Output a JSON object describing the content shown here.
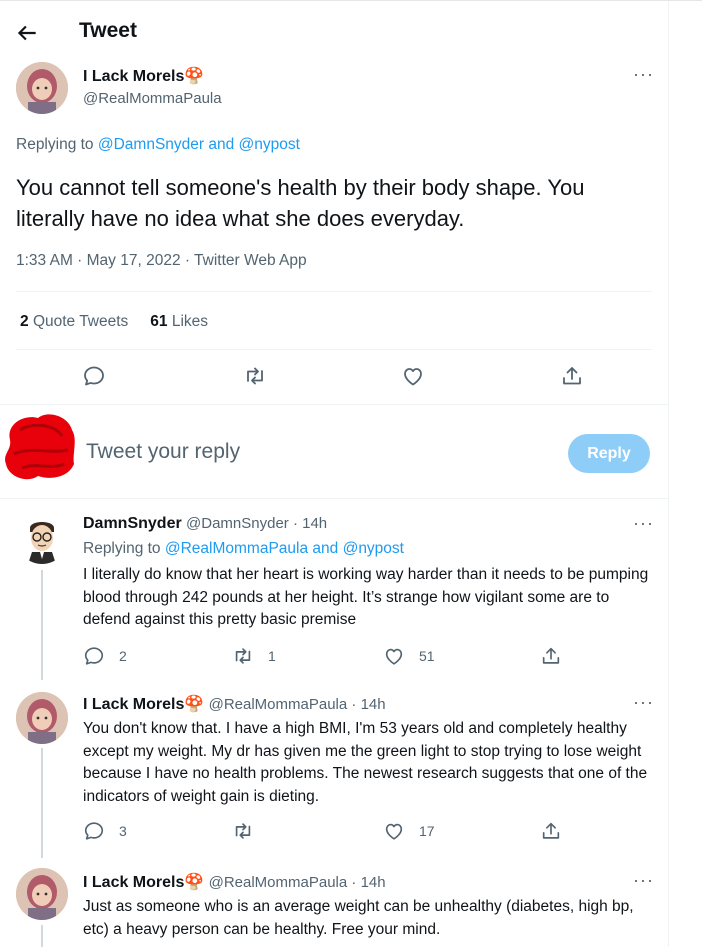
{
  "header": {
    "title": "Tweet",
    "back_label": "back"
  },
  "main_tweet": {
    "display_name": "I Lack Morels",
    "name_emoji": "🍄",
    "handle": "@RealMommaPaula",
    "replying_prefix": "Replying to ",
    "replying_to_1": "@DamnSnyder",
    "replying_and": " and ",
    "replying_to_2": "@nypost",
    "text": "You cannot tell someone's health by their body shape. You literally have no idea what she does everyday.",
    "meta": "1:33 AM · May 17, 2022 · Twitter Web App",
    "quote_count": "2",
    "quote_label": "Quote Tweets",
    "like_count": "61",
    "like_label": "Likes"
  },
  "compose": {
    "placeholder": "Tweet your reply",
    "reply_button": "Reply"
  },
  "replies": [
    {
      "display_name": "DamnSnyder",
      "handle": "@DamnSnyder",
      "time": " · 14h",
      "replying_prefix": "Replying to ",
      "replying_to_1": "@RealMommaPaula",
      "replying_and": " and ",
      "replying_to_2": "@nypost",
      "text": "I literally do know that her heart is working way harder than it needs to be pumping blood through 242 pounds at her height. It’s strange how vigilant some are to defend against this pretty basic premise",
      "reply_count": "2",
      "retweet_count": "1",
      "like_count": "51"
    },
    {
      "display_name": "I Lack Morels",
      "name_emoji": "🍄",
      "handle": "@RealMommaPaula",
      "time": " · 14h",
      "text": "You don't know that. I have a high BMI, I'm 53 years old and completely healthy except my weight. My dr has given me the green light to stop trying to lose weight because I have no health problems. The newest research suggests that one of the indicators of weight gain is dieting.",
      "reply_count": "3",
      "retweet_count": "",
      "like_count": "17"
    },
    {
      "display_name": "I Lack Morels",
      "name_emoji": "🍄",
      "handle": "@RealMommaPaula",
      "time": " · 14h",
      "text": "Just as someone who is an average weight can be unhealthy (diabetes, high bp, etc) a heavy person can be healthy. Free your mind."
    }
  ],
  "colors": {
    "accent": "#1d9bf0",
    "reply_button": "#8ecdf8",
    "muted": "#536471",
    "text": "#0f1419",
    "redaction": "#e8000b"
  },
  "icons": [
    "back-arrow-icon",
    "more-icon",
    "reply-icon",
    "retweet-icon",
    "like-icon",
    "share-icon",
    "mushroom-emoji"
  ]
}
